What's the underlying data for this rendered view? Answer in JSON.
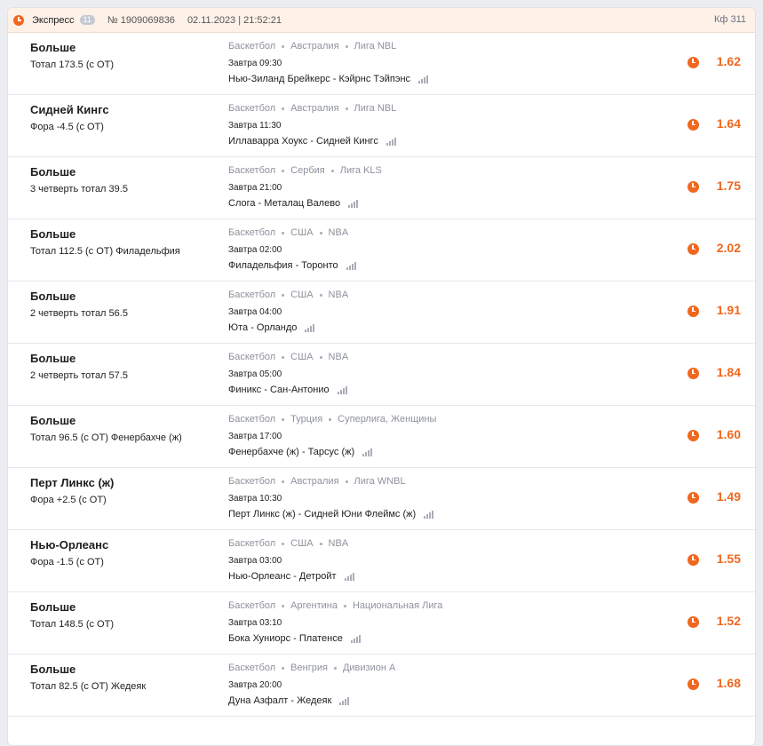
{
  "header": {
    "icon": "clock-icon",
    "title": "Экспресс",
    "count_badge": "11",
    "bet_number": "№ 1909069836",
    "datetime": "02.11.2023 | 21:52:21",
    "total_coef": "Кф 311"
  },
  "bets": [
    {
      "outcome": "Больше",
      "market": "Тотал 173.5 (с ОТ)",
      "sport": "Баскетбол",
      "country": "Австралия",
      "league": "Лига NBL",
      "time": "Завтра 09:30",
      "match": "Нью-Зиланд Брейкерс - Кэйрнс Тэйпэнс",
      "odds": "1.62"
    },
    {
      "outcome": "Сидней Кингс",
      "market": "Фора -4.5 (с ОТ)",
      "sport": "Баскетбол",
      "country": "Австралия",
      "league": "Лига NBL",
      "time": "Завтра 11:30",
      "match": "Иллаварра Хоукс - Сидней Кингс",
      "odds": "1.64"
    },
    {
      "outcome": "Больше",
      "market": "3 четверть тотал 39.5",
      "sport": "Баскетбол",
      "country": "Сербия",
      "league": "Лига KLS",
      "time": "Завтра 21:00",
      "match": "Слога - Металац Валево",
      "odds": "1.75"
    },
    {
      "outcome": "Больше",
      "market": "Тотал 112.5 (с ОТ) Филадельфия",
      "sport": "Баскетбол",
      "country": "США",
      "league": "NBA",
      "time": "Завтра 02:00",
      "match": "Филадельфия - Торонто",
      "odds": "2.02"
    },
    {
      "outcome": "Больше",
      "market": "2 четверть тотал 56.5",
      "sport": "Баскетбол",
      "country": "США",
      "league": "NBA",
      "time": "Завтра 04:00",
      "match": "Юта - Орландо",
      "odds": "1.91"
    },
    {
      "outcome": "Больше",
      "market": "2 четверть тотал 57.5",
      "sport": "Баскетбол",
      "country": "США",
      "league": "NBA",
      "time": "Завтра 05:00",
      "match": "Финикс - Сан-Антонио",
      "odds": "1.84"
    },
    {
      "outcome": "Больше",
      "market": "Тотал 96.5 (с ОТ) Фенербахче (ж)",
      "sport": "Баскетбол",
      "country": "Турция",
      "league": "Суперлига, Женщины",
      "time": "Завтра 17:00",
      "match": "Фенербахче (ж) - Тарсус (ж)",
      "odds": "1.60"
    },
    {
      "outcome": "Перт Линкс (ж)",
      "market": "Фора +2.5 (с ОТ)",
      "sport": "Баскетбол",
      "country": "Австралия",
      "league": "Лига WNBL",
      "time": "Завтра 10:30",
      "match": "Перт Линкс (ж) - Сидней Юни Флеймс (ж)",
      "odds": "1.49"
    },
    {
      "outcome": "Нью-Орлеанс",
      "market": "Фора -1.5 (с ОТ)",
      "sport": "Баскетбол",
      "country": "США",
      "league": "NBA",
      "time": "Завтра 03:00",
      "match": "Нью-Орлеанс - Детройт",
      "odds": "1.55"
    },
    {
      "outcome": "Больше",
      "market": "Тотал 148.5 (с ОТ)",
      "sport": "Баскетбол",
      "country": "Аргентина",
      "league": "Национальная Лига",
      "time": "Завтра 03:10",
      "match": "Бока Хуниорс - Платенсе",
      "odds": "1.52"
    },
    {
      "outcome": "Больше",
      "market": "Тотал 82.5 (с ОТ) Жедеяк",
      "sport": "Баскетбол",
      "country": "Венгрия",
      "league": "Дивизион А",
      "time": "Завтра 20:00",
      "match": "Дуна Азфалт - Жедеяк",
      "odds": "1.68"
    }
  ],
  "colors": {
    "accent": "#f0681f",
    "header_bg": "#fdf1e8",
    "muted": "#8e929c"
  },
  "icons": {
    "row_status": "clock-icon",
    "stats": "stats-bars-icon"
  }
}
